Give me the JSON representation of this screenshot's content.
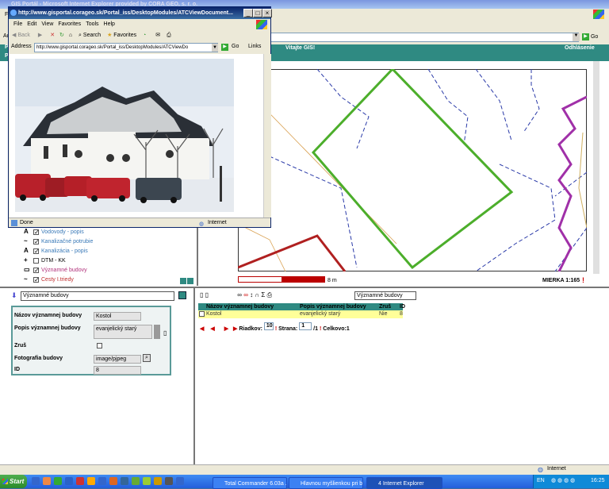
{
  "main_window": {
    "title": "GIS Portál - Microsoft Internet Explorer provided by CORA GEO, s. r. o.",
    "menu_first": "F",
    "address_first": "Ad",
    "go_label": "Go"
  },
  "portal": {
    "welcome": "Vitajte GIS!",
    "logout": "Odhlásenie",
    "first_letter_top": "P",
    "first_letter_bottom": "P"
  },
  "popup": {
    "title": "http://www.gisportal.corageo.sk/Portal_iss/DesktopModules/ATCViewDocument...",
    "menu": [
      "File",
      "Edit",
      "View",
      "Favorites",
      "Tools",
      "Help"
    ],
    "toolbar": {
      "back": "Back",
      "search": "Search",
      "favorites": "Favorites"
    },
    "address_label": "Address",
    "address_value": "http://www.gisportal.corageo.sk/Portal_iss/DesktopModules/ATCViewDo",
    "go_label": "Go",
    "links_label": "Links",
    "status_done": "Done",
    "status_zone": "Internet"
  },
  "layers": {
    "items": [
      {
        "icon": "A",
        "label": "Vodovody - popis",
        "color": "#3a7ab8",
        "checked": true
      },
      {
        "icon": "~",
        "label": "Kanalizačné potrubie",
        "color": "#3a7ab8",
        "checked": true
      },
      {
        "icon": "A",
        "label": "Kanalizácia - popis",
        "color": "#3a7ab8",
        "checked": true
      },
      {
        "icon": "+",
        "label": "DTM - KK",
        "color": "#000",
        "checked": false
      },
      {
        "icon": "▭",
        "label": "Významné budovy",
        "color": "#b0307a",
        "checked": true
      },
      {
        "icon": "~",
        "label": "Cesty I.triedy",
        "color": "#c03030",
        "checked": true
      }
    ]
  },
  "map": {
    "scale_bar_label": "8 m",
    "scale_label": "MIERKA 1:165"
  },
  "attribute_panel": {
    "layer_select": "Významné budovy",
    "fields": [
      {
        "label": "Názov významnej budovy",
        "value": "Kostol"
      },
      {
        "label": "Popis významnej budovy",
        "value": "evanjelický starý"
      },
      {
        "label": "Zruš",
        "value": ""
      },
      {
        "label": "Fotografia budovy",
        "value": "image/pjpeg"
      },
      {
        "label": "ID",
        "value": "8"
      }
    ]
  },
  "results": {
    "layer_select": "Významné budovy",
    "columns": [
      "Názov významnej budovy",
      "Popis významnej budovy",
      "Zruš",
      "ID"
    ],
    "rows": [
      [
        "Kostol",
        "evanjelický starý",
        "Nie",
        "8"
      ]
    ],
    "pager": {
      "rows_label": "Riadkov:",
      "rows_value": "10",
      "page_label": "Strana:",
      "page_value": "1",
      "page_total": "/1",
      "total_label": "Celkovo:1"
    }
  },
  "ie_status": {
    "zone": "Internet"
  },
  "taskbar": {
    "start": "Start",
    "buttons": [
      "Total Commander 6.03a ...",
      "Hlavnou myšlienkou pri b...",
      "4 Internet Explorer"
    ],
    "lang": "EN",
    "clock": "16:25"
  }
}
